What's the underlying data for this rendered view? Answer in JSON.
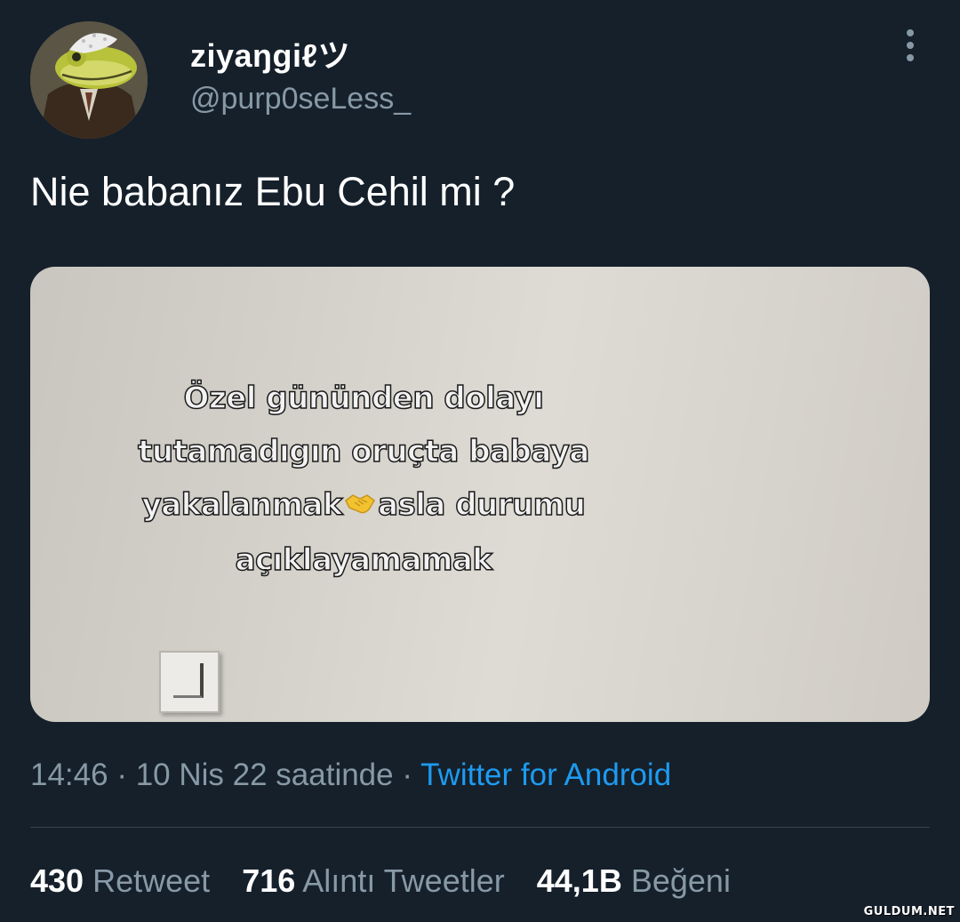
{
  "user": {
    "display_name": "ziyaŋgiℓツ",
    "handle": "@purp0seLess_",
    "avatar_icon": "frog-avatar"
  },
  "tweet": {
    "text": "Nie babanız Ebu Cehil mi ?"
  },
  "media": {
    "lines": [
      "Özel gününden dolayı",
      "tutamadıgın oruçta babaya",
      "yakalanmak",
      "asla durumu",
      "açıklayamamak"
    ],
    "emoji_icon": "handshake-icon"
  },
  "meta": {
    "time": "14:46",
    "separator": " · ",
    "date": "10 Nis 22 saatinde",
    "source": "Twitter for Android"
  },
  "stats": {
    "retweets": {
      "count": "430",
      "label": "Retweet"
    },
    "quotes": {
      "count": "716",
      "label": "Alıntı Tweetler"
    },
    "likes": {
      "count": "44,1B",
      "label": "Beğeni"
    }
  },
  "watermark": "GULDUM.NET",
  "colors": {
    "background": "#15202b",
    "secondary_text": "#8899a6",
    "link": "#1d9bf0",
    "divider": "#38444d"
  }
}
